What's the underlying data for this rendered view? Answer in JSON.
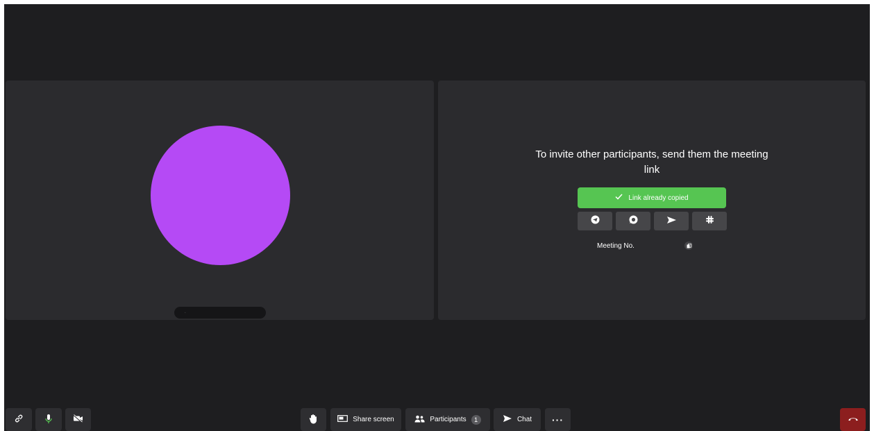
{
  "invite": {
    "title": "To invite other participants, send them the meeting link",
    "copied_label": "Link already copied",
    "share_targets": [
      "telegram-icon",
      "whatsapp-icon",
      "send-icon",
      "slack-icon"
    ],
    "meeting_no_label": "Meeting No."
  },
  "participant": {
    "avatar_color": "#b54af5",
    "name": "."
  },
  "toolbar": {
    "share_screen": "Share screen",
    "participants": "Participants",
    "participants_count": "1",
    "chat": "Chat",
    "more": "···"
  },
  "colors": {
    "background": "#1e1e20",
    "tile": "#2b2b2e",
    "accent_green": "#56c552",
    "hangup_red": "#8c1e1e",
    "mic_green": "#56c552"
  }
}
